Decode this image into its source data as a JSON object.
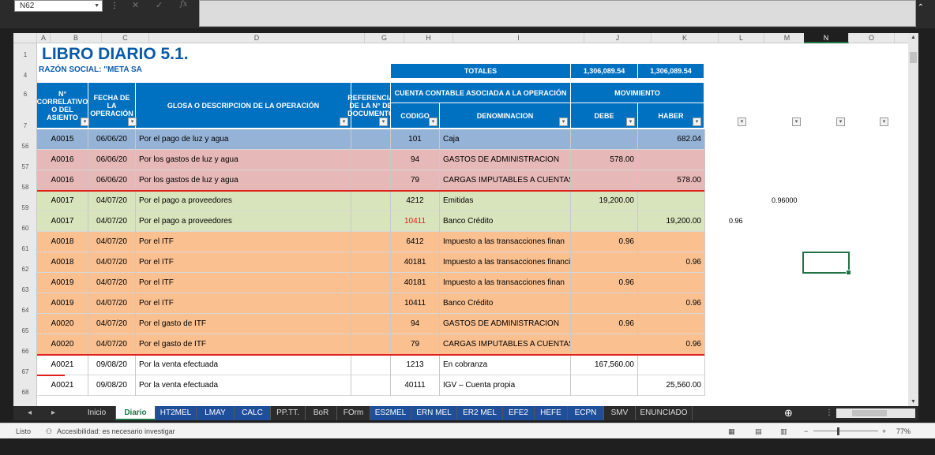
{
  "formula_bar": {
    "name_box": "N62",
    "fx": "fx"
  },
  "columns": [
    "A",
    "B",
    "C",
    "D",
    "G",
    "H",
    "I",
    "J",
    "K",
    "L",
    "M",
    "N",
    "O"
  ],
  "row_numbers": [
    "1",
    "4",
    "6",
    "7",
    "56",
    "57",
    "58",
    "59",
    "60",
    "61",
    "62",
    "63",
    "64",
    "65",
    "66",
    "67",
    "68"
  ],
  "sheet": {
    "title": "LIBRO DIARIO 5.1.",
    "razon": "RAZÓN SOCIAL: \"META SA",
    "totales_label": "TOTALES",
    "total_debe": "1,306,089.54",
    "total_haber": "1,306,089.54",
    "headers": {
      "correlativo": "N° CORRELATIVO O DEL ASIENTO",
      "fecha": "FECHA DE LA OPERACIÓN",
      "glosa": "GLOSA O DESCRIPCION DE LA OPERACIÓN",
      "referencia": "REFERENCIA DE LA N° DE DOCUMENTO",
      "cuenta": "CUENTA CONTABLE ASOCIADA A LA OPERACIÓN",
      "movimiento": "MOVIMIENTO",
      "codigo": "CODIGO",
      "denominacion": "DENOMINACION",
      "debe": "DEBE",
      "haber": "HABER"
    }
  },
  "rows": [
    {
      "n": "A0015",
      "fecha": "06/06/20",
      "glosa": "Por el pago de luz y agua",
      "codigo": "101",
      "den": "Caja",
      "debe": "",
      "haber": "682.04",
      "color": "#95b3d7"
    },
    {
      "n": "A0016",
      "fecha": "06/06/20",
      "glosa": "Por los gastos de luz y agua",
      "codigo": "94",
      "den": "GASTOS DE ADMINISTRACION",
      "debe": "578.00",
      "haber": "",
      "color": "#e6b8b7"
    },
    {
      "n": "A0016",
      "fecha": "06/06/20",
      "glosa": "Por los gastos de luz y agua",
      "codigo": "79",
      "den": "CARGAS IMPUTABLES A CUENTAS DE COSTOS Y GA",
      "debe": "",
      "haber": "578.00",
      "color": "#e6b8b7"
    },
    {
      "n": "A0017",
      "fecha": "04/07/20",
      "glosa": "Por el pago a proveedores",
      "codigo": "4212",
      "den": "Emitidas",
      "debe": "19,200.00",
      "haber": "",
      "color": "#d8e4bc"
    },
    {
      "n": "A0017",
      "fecha": "04/07/20",
      "glosa": "Por el pago a proveedores",
      "codigo": "10411",
      "den": "Banco Crédito",
      "debe": "",
      "haber": "19,200.00",
      "color": "#d8e4bc",
      "codered": true
    },
    {
      "n": "A0018",
      "fecha": "04/07/20",
      "glosa": "Por el ITF",
      "codigo": "6412",
      "den": "Impuesto a las transacciones finan",
      "debe": "0.96",
      "haber": "",
      "color": "#fac090"
    },
    {
      "n": "A0018",
      "fecha": "04/07/20",
      "glosa": "Por el ITF",
      "codigo": "40181",
      "den": "Impuesto a las transacciones financieras",
      "debe": "",
      "haber": "0.96",
      "color": "#fac090"
    },
    {
      "n": "A0019",
      "fecha": "04/07/20",
      "glosa": "Por el ITF",
      "codigo": "40181",
      "den": "Impuesto a las transacciones finan",
      "debe": "0.96",
      "haber": "",
      "color": "#fac090"
    },
    {
      "n": "A0019",
      "fecha": "04/07/20",
      "glosa": "Por el ITF",
      "codigo": "10411",
      "den": "Banco Crédito",
      "debe": "",
      "haber": "0.96",
      "color": "#fac090"
    },
    {
      "n": "A0020",
      "fecha": "04/07/20",
      "glosa": "Por el gasto de ITF",
      "codigo": "94",
      "den": "GASTOS DE ADMINISTRACION",
      "debe": "0.96",
      "haber": "",
      "color": "#fac090"
    },
    {
      "n": "A0020",
      "fecha": "04/07/20",
      "glosa": "Por el gasto de ITF",
      "codigo": "79",
      "den": "CARGAS IMPUTABLES A CUENTAS DE COSTOS Y GA",
      "debe": "",
      "haber": "0.96",
      "color": "#fac090"
    },
    {
      "n": "A0021",
      "fecha": "09/08/20",
      "glosa": "Por la venta efectuada",
      "codigo": "1213",
      "den": "En cobranza",
      "debe": "167,560.00",
      "haber": "",
      "color": "#ffffff"
    },
    {
      "n": "A0021",
      "fecha": "09/08/20",
      "glosa": "Por la venta efectuada",
      "codigo": "40111",
      "den": "IGV – Cuenta propia",
      "debe": "",
      "haber": "25,560.00",
      "color": "#ffffff"
    }
  ],
  "outside_values": {
    "m59": "0.96000",
    "l60": "0.96"
  },
  "tabs": [
    {
      "label": "Inicio",
      "style": "plain"
    },
    {
      "label": "Diario",
      "style": "active"
    },
    {
      "label": "HT2MEL",
      "style": "blue"
    },
    {
      "label": "LMAY",
      "style": "blue"
    },
    {
      "label": "CALC",
      "style": "blue"
    },
    {
      "label": "PP.TT.",
      "style": "plain"
    },
    {
      "label": "BoR",
      "style": "plain"
    },
    {
      "label": "FOrm",
      "style": "plain"
    },
    {
      "label": "ES2MEL",
      "style": "blue"
    },
    {
      "label": "ERN MEL",
      "style": "blue"
    },
    {
      "label": "ER2 MEL",
      "style": "blue"
    },
    {
      "label": "EFE2",
      "style": "blue"
    },
    {
      "label": "HEFE",
      "style": "blue"
    },
    {
      "label": "ECPN",
      "style": "blue"
    },
    {
      "label": "SMV",
      "style": "plain"
    },
    {
      "label": "ENUNCIADO",
      "style": "plain"
    }
  ],
  "status": {
    "ready": "Listo",
    "accessibility": "Accesibilidad: es necesario investigar",
    "zoom": "77%"
  }
}
